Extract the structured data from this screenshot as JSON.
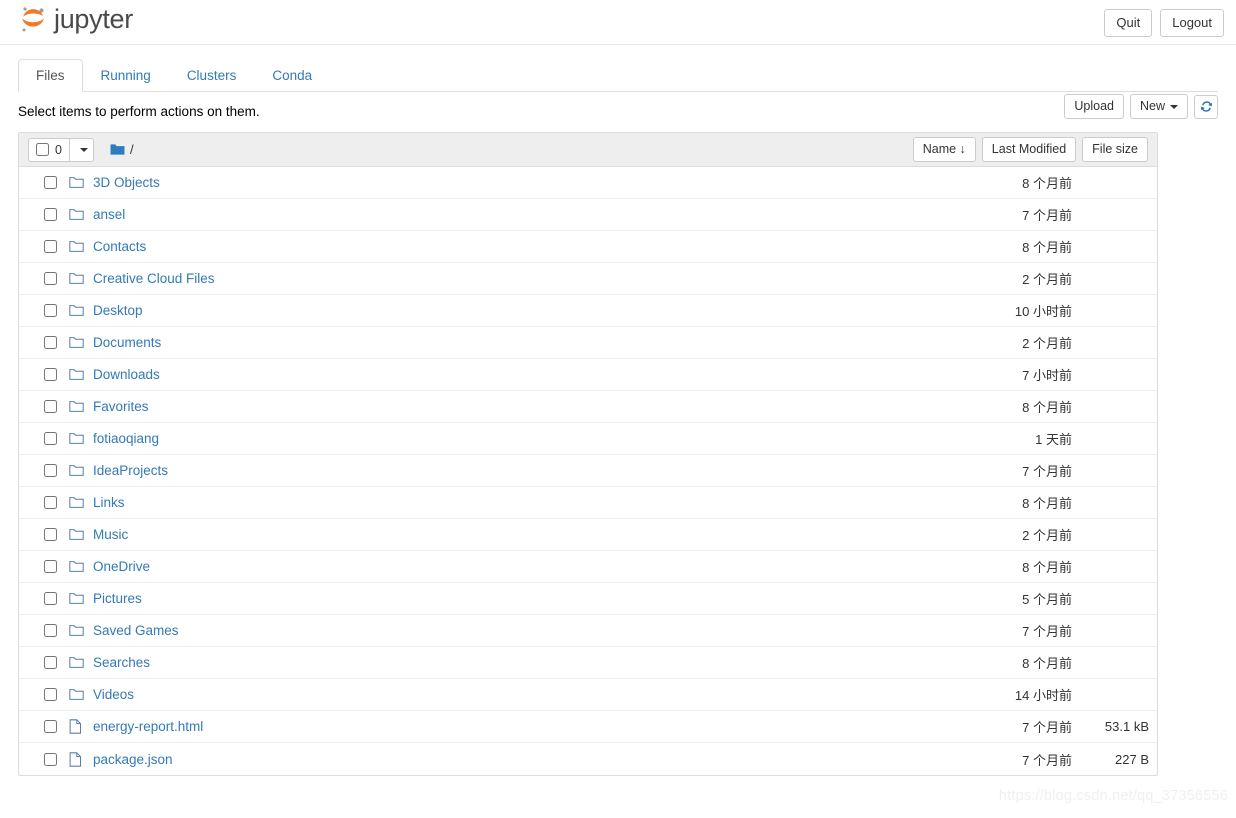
{
  "header": {
    "brand": "jupyter",
    "logo_icon": "jupyter-logo-icon",
    "logo_color": "#f37726",
    "quit_label": "Quit",
    "logout_label": "Logout"
  },
  "tabs": [
    {
      "label": "Files",
      "active": true
    },
    {
      "label": "Running",
      "active": false
    },
    {
      "label": "Clusters",
      "active": false
    },
    {
      "label": "Conda",
      "active": false
    }
  ],
  "toolbar": {
    "notice": "Select items to perform actions on them.",
    "upload_label": "Upload",
    "new_label": "New",
    "new_caret_icon": "chevron-down-icon",
    "refresh_icon": "refresh-icon"
  },
  "list_header": {
    "selected_count": "0",
    "select_all_checkbox": false,
    "select_caret_icon": "chevron-down-icon",
    "breadcrumb_icon": "folder-icon",
    "breadcrumb_path": "/",
    "sort_name_label": "Name",
    "sort_name_arrow": "↓",
    "sort_modified_label": "Last Modified",
    "sort_size_label": "File size"
  },
  "colors": {
    "link": "#337ab7",
    "folder_icon": "#5b7fa6",
    "breadcrumb_folder": "#2b7cc0",
    "header_bg": "#eeeeee"
  },
  "rows": [
    {
      "icon": "folder-icon",
      "type": "folder",
      "name": "3D Objects",
      "modified": "8 个月前",
      "size": ""
    },
    {
      "icon": "folder-icon",
      "type": "folder",
      "name": "ansel",
      "modified": "7 个月前",
      "size": ""
    },
    {
      "icon": "folder-icon",
      "type": "folder",
      "name": "Contacts",
      "modified": "8 个月前",
      "size": ""
    },
    {
      "icon": "folder-icon",
      "type": "folder",
      "name": "Creative Cloud Files",
      "modified": "2 个月前",
      "size": ""
    },
    {
      "icon": "folder-icon",
      "type": "folder",
      "name": "Desktop",
      "modified": "10 小时前",
      "size": ""
    },
    {
      "icon": "folder-icon",
      "type": "folder",
      "name": "Documents",
      "modified": "2 个月前",
      "size": ""
    },
    {
      "icon": "folder-icon",
      "type": "folder",
      "name": "Downloads",
      "modified": "7 小时前",
      "size": ""
    },
    {
      "icon": "folder-icon",
      "type": "folder",
      "name": "Favorites",
      "modified": "8 个月前",
      "size": ""
    },
    {
      "icon": "folder-icon",
      "type": "folder",
      "name": "fotiaoqiang",
      "modified": "1 天前",
      "size": ""
    },
    {
      "icon": "folder-icon",
      "type": "folder",
      "name": "IdeaProjects",
      "modified": "7 个月前",
      "size": ""
    },
    {
      "icon": "folder-icon",
      "type": "folder",
      "name": "Links",
      "modified": "8 个月前",
      "size": ""
    },
    {
      "icon": "folder-icon",
      "type": "folder",
      "name": "Music",
      "modified": "2 个月前",
      "size": ""
    },
    {
      "icon": "folder-icon",
      "type": "folder",
      "name": "OneDrive",
      "modified": "8 个月前",
      "size": ""
    },
    {
      "icon": "folder-icon",
      "type": "folder",
      "name": "Pictures",
      "modified": "5 个月前",
      "size": ""
    },
    {
      "icon": "folder-icon",
      "type": "folder",
      "name": "Saved Games",
      "modified": "7 个月前",
      "size": ""
    },
    {
      "icon": "folder-icon",
      "type": "folder",
      "name": "Searches",
      "modified": "8 个月前",
      "size": ""
    },
    {
      "icon": "folder-icon",
      "type": "folder",
      "name": "Videos",
      "modified": "14 小时前",
      "size": ""
    },
    {
      "icon": "file-icon",
      "type": "file",
      "name": "energy-report.html",
      "modified": "7 个月前",
      "size": "53.1 kB"
    },
    {
      "icon": "file-icon",
      "type": "file",
      "name": "package.json",
      "modified": "7 个月前",
      "size": "227 B"
    }
  ],
  "watermark": "https://blog.csdn.net/qq_37356556"
}
